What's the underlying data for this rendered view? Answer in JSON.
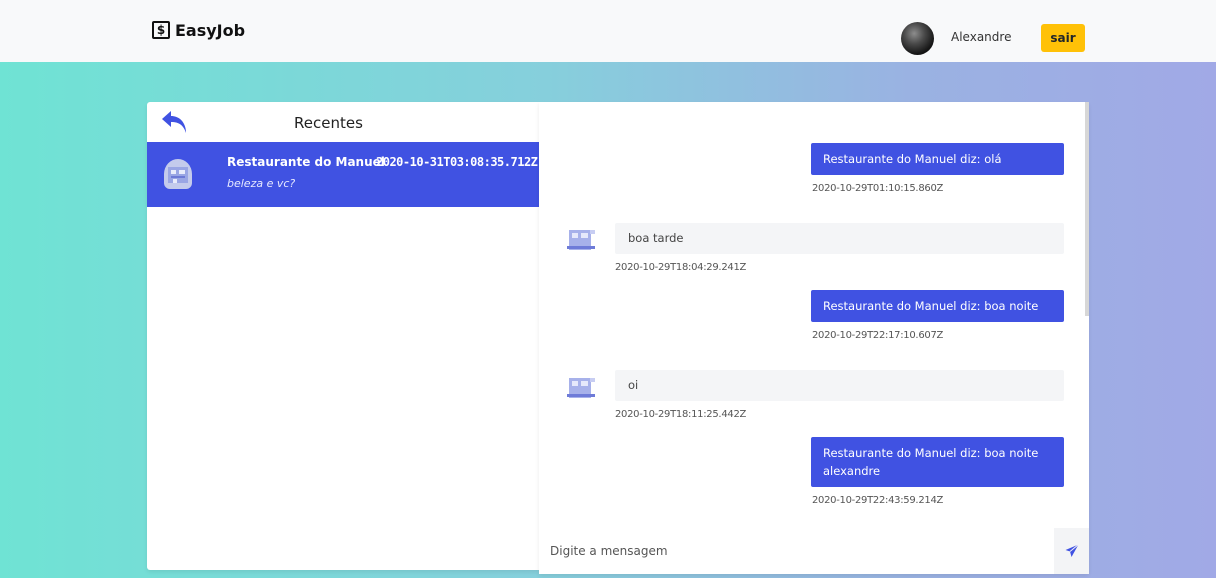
{
  "app": {
    "brand": "EasyJob",
    "brand_icon_glyph": "$"
  },
  "navbar": {
    "user_name": "Alexandre",
    "logout_label": "sair",
    "logout_color": "#ffc107"
  },
  "contacts": {
    "title": "Recentes",
    "back_icon": "back-arrow-icon",
    "items": [
      {
        "name": "Restaurante do Manuel",
        "time": "2020-10-31T03:08:35.712Z",
        "last_message": "beleza e vc?"
      }
    ]
  },
  "chat": {
    "messages": [
      {
        "direction": "out",
        "text": "Restaurante do Manuel diz: olá",
        "time": "2020-10-29T01:10:15.860Z"
      },
      {
        "direction": "in",
        "text": "boa tarde",
        "time": "2020-10-29T18:04:29.241Z"
      },
      {
        "direction": "out",
        "text": "Restaurante do Manuel diz: boa noite",
        "time": "2020-10-29T22:17:10.607Z"
      },
      {
        "direction": "in",
        "text": "oi",
        "time": "2020-10-29T18:11:25.442Z"
      },
      {
        "direction": "out",
        "text": "Restaurante do Manuel diz: boa noite alexandre",
        "time": "2020-10-29T22:43:59.214Z"
      }
    ],
    "input_placeholder": "Digite a mensagem",
    "send_icon": "send-icon"
  },
  "colors": {
    "accent": "#4052e2",
    "incoming_bubble": "#f4f5f7",
    "gradient_start": "#6fe3d4",
    "gradient_end": "#a1a9e6"
  }
}
